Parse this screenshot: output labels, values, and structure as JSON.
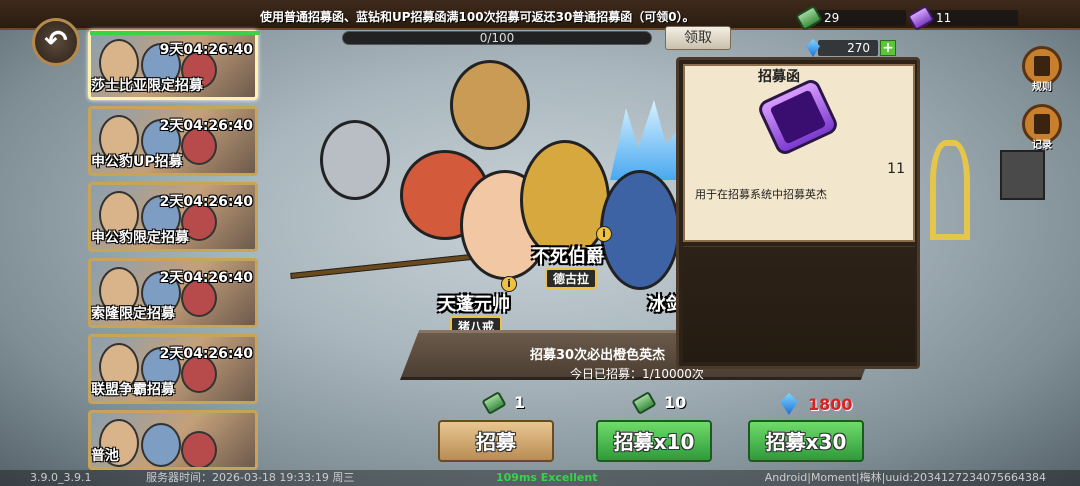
{
  "notice": "使用普通招募函、蓝钻和UP招募函满100次招募可返还30普通招募函（可领0）。",
  "resources": {
    "green_scroll": "29",
    "purple_scroll": "11",
    "gems": "270",
    "plus": "+"
  },
  "back_glyph": "↶",
  "progress": {
    "text": "0/100",
    "value": 0
  },
  "claim_button": "领取",
  "banners": [
    {
      "timer": "9天04:26:40",
      "name": "莎士比亚限定招募"
    },
    {
      "timer": "2天04:26:40",
      "name": "申公豹UP招募"
    },
    {
      "timer": "2天04:26:40",
      "name": "申公豹限定招募"
    },
    {
      "timer": "2天04:26:40",
      "name": "索隆限定招募"
    },
    {
      "timer": "2天04:26:40",
      "name": "联盟争霸招募"
    },
    {
      "timer": "",
      "name": "普池"
    }
  ],
  "heroes": {
    "hero1": {
      "name": "天蓬元帅",
      "tag": "猪八戒"
    },
    "hero2": {
      "name": "不死伯爵",
      "tag": "德古拉"
    },
    "hero3": {
      "name": "冰剑"
    }
  },
  "scroll_banner": {
    "line1": "招募30次必出橙色英杰",
    "line2": "今日已招募：1/10000次"
  },
  "item_panel": {
    "title": "招募函",
    "count": "11",
    "description": "用于在招募系统中招募英杰"
  },
  "side_buttons": {
    "rules": "规则",
    "records": "记录"
  },
  "costs": {
    "single": "1",
    "ten": "10",
    "thirty": "1800"
  },
  "buttons": {
    "recruit1": "招募",
    "recruit10": "招募x10",
    "recruit30": "招募x30"
  },
  "footer": {
    "version": "3.9.0_3.9.1",
    "server_time": "服务器时间：2026-03-18  19:33:19  周三",
    "network": "109ms Excellent",
    "device": "Android|Moment|梅林|uuid:2034127234075664384"
  },
  "colors": {
    "accent_green": "#39d24a",
    "gem_cost_red": "#e02020",
    "wood_border": "#c8a35a"
  },
  "icons": [
    "back-arrow-icon",
    "green-scroll-icon",
    "purple-scroll-icon",
    "gem-icon",
    "info-icon",
    "rules-icon",
    "records-icon"
  ]
}
